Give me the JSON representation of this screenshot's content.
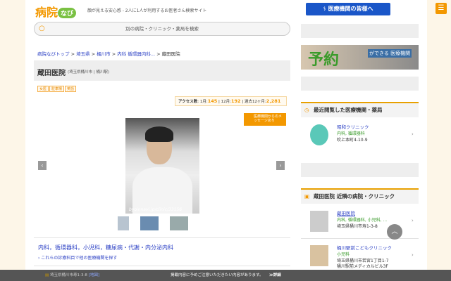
{
  "header": {
    "logo": "病院",
    "logo_badge": "なび",
    "tagline": "顔が見える安心感 - 2人に1人が利用するお医者さん検索サイト",
    "pro_button": "医療機関の皆様へ",
    "search_placeholder": "別の病院・クリニック・薬局を検索"
  },
  "breadcrumb": [
    "病院なびトップ",
    "埼玉県",
    "桶川市",
    "内科 循環器内科...",
    "蔵田医院"
  ],
  "clinic": {
    "name": "蔵田医院",
    "location": "(埼玉県桶川市 | 桶川駅)",
    "tags": [
      "女医",
      "駐車場",
      "英語"
    ],
    "access": {
      "label": "アクセス数",
      "m1_label": "1月:",
      "m1": "145",
      "m12_label": "12月:",
      "m12": "192",
      "y_label": "過去12ヶ月:",
      "y": "2,281"
    },
    "message_button": "医療機関からのメッセージあり",
    "photo_caption": "byoinnavi.jp/clinic/33156",
    "departments": "内科，循環器科，小児科，糖尿病・代謝・内分泌内科",
    "search_departments": "これらの診療科目で他の医療機関を探す"
  },
  "sidebar": {
    "ad": {
      "big": "予約",
      "small": "ができる 医療機関"
    },
    "recent_title": "最近閲覧した医療機関・薬局",
    "recent": [
      {
        "name": "昭和クリニック",
        "dept": "内科, 循環器科",
        "addr": "吹上本町4-10-9"
      }
    ],
    "nearby_title": "蔵田医院 近隣の病院・クリニック",
    "nearby": [
      {
        "name": "蔵田医院",
        "dept": "内科, 循環器科, 小児科, ...",
        "addr": "埼玉県桶川市寿1-3-8",
        "addr2": ""
      },
      {
        "name": "桶川駅前こどもクリニック",
        "dept": "小児科",
        "addr": "埼玉県桶川市若宮1丁目1-7",
        "addr2": "桶川駅前メディカルビル3F"
      }
    ]
  },
  "footer": {
    "address": "埼玉県桶川市寿1-3-8",
    "map": "[地図]",
    "note": "掲載内容に予めご注意いただきたい内容があります。",
    "more": "≫詳細"
  }
}
